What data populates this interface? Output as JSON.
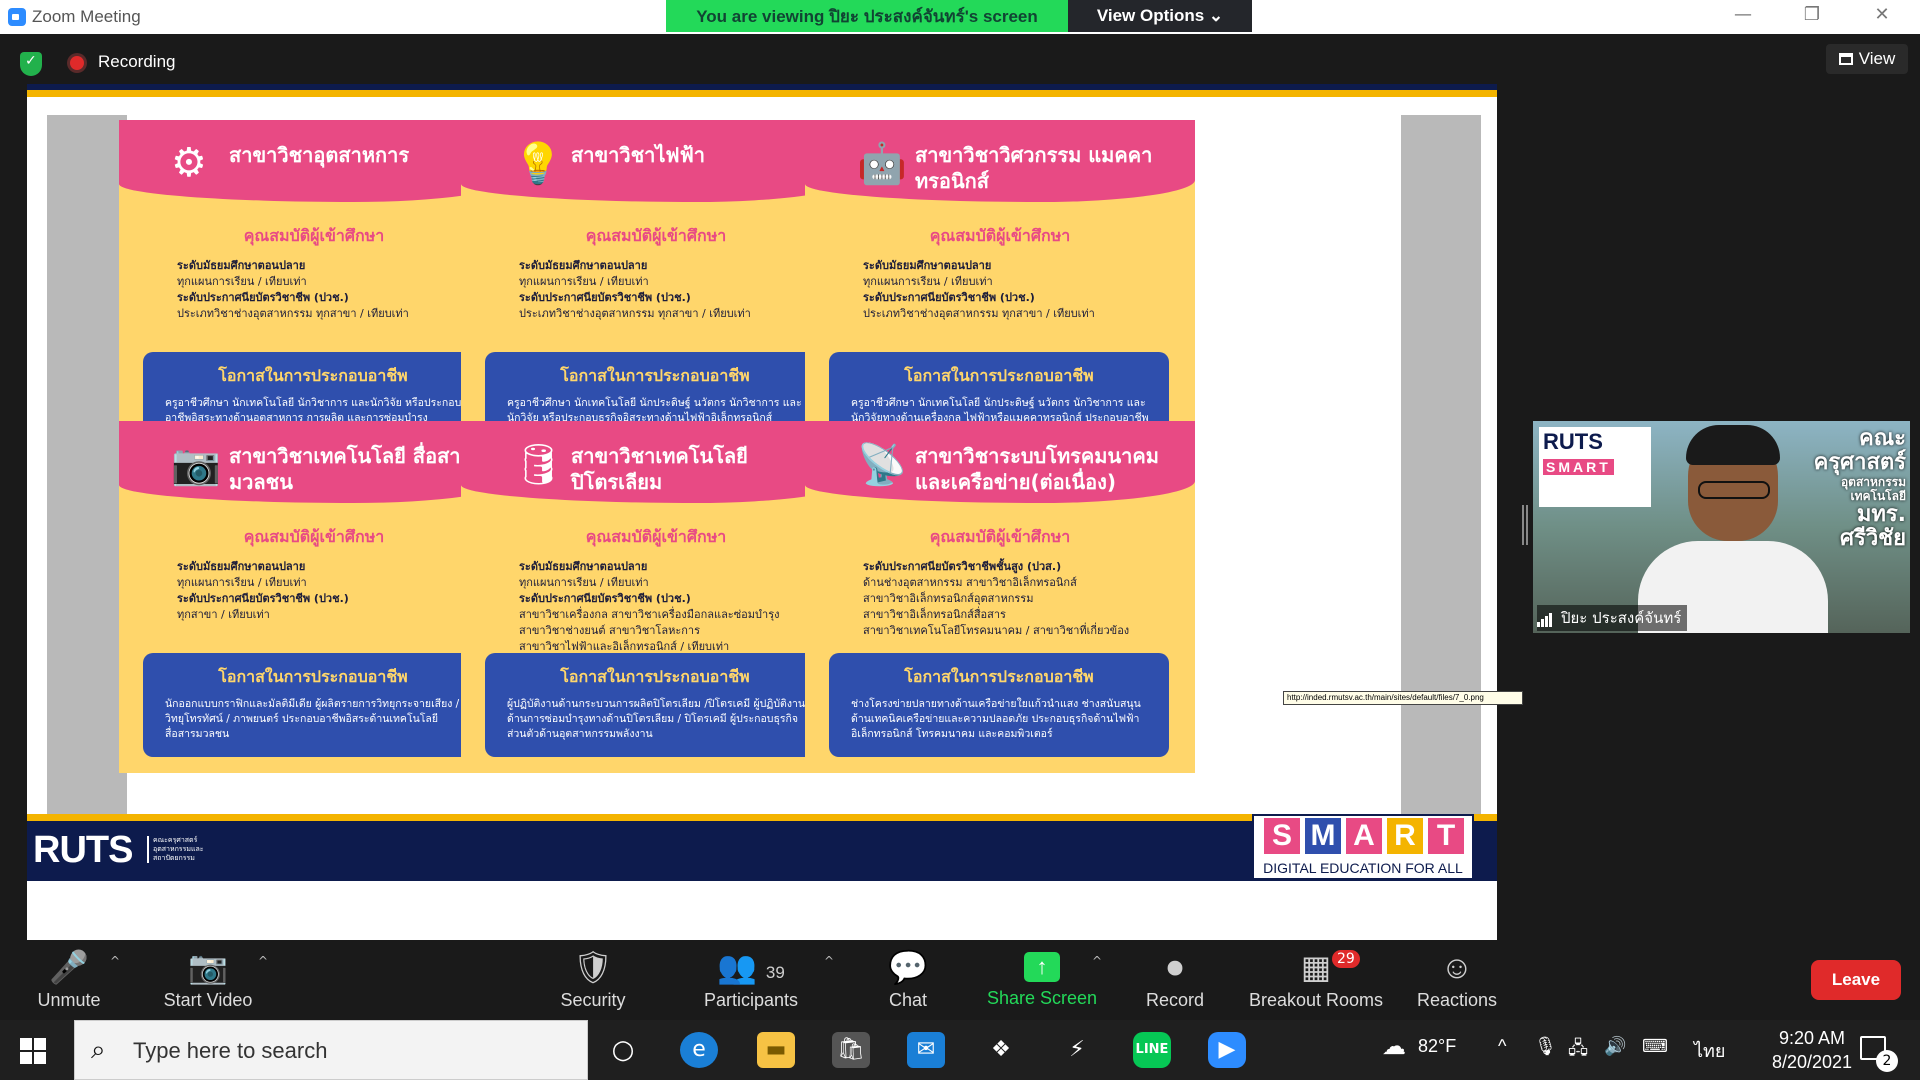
{
  "titlebar": {
    "title": "Zoom Meeting",
    "viewing": "You are viewing ปิยะ ประสงค์จันทร์'s screen",
    "view_options": "View Options ⌄",
    "minimize": "—",
    "restore": "❐",
    "close": "✕"
  },
  "meeting": {
    "recording": "Recording",
    "view_label": "View"
  },
  "cards": [
    {
      "title": "สาขาวิชาอุตสาหการ",
      "icon": "⚙",
      "sub": "คุณสมบัติผู้เข้าศึกษา",
      "body": [
        {
          "t": "ระดับมัธยมศึกษาตอนปลาย",
          "b": true
        },
        {
          "t": "ทุกแผนการเรียน / เทียบเท่า",
          "b": false
        },
        {
          "t": "ระดับประกาศนียบัตรวิชาชีพ (ปวช.)",
          "b": true
        },
        {
          "t": "ประเภทวิชาช่างอุตสาหกรรม ทุกสาขา / เทียบเท่า",
          "b": false
        }
      ],
      "opp_title": "โอกาสในการประกอบอาชีพ",
      "opp_text": "ครูอาชีวศึกษา นักเทคโนโลยี นักวิชาการ และนักวิจัย หรือประกอบอาชีพอิสระทางด้านอุตสาหการ การผลิต และการซ่อมบำรุง"
    },
    {
      "title": "สาขาวิชาไฟฟ้า",
      "icon": "💡",
      "sub": "คุณสมบัติผู้เข้าศึกษา",
      "body": [
        {
          "t": "ระดับมัธยมศึกษาตอนปลาย",
          "b": true
        },
        {
          "t": "ทุกแผนการเรียน / เทียบเท่า",
          "b": false
        },
        {
          "t": "ระดับประกาศนียบัตรวิชาชีพ (ปวช.)",
          "b": true
        },
        {
          "t": "ประเภทวิชาช่างอุตสาหกรรม ทุกสาขา / เทียบเท่า",
          "b": false
        }
      ],
      "opp_title": "โอกาสในการประกอบอาชีพ",
      "opp_text": "ครูอาชีวศึกษา นักเทคโนโลยี นักประดิษฐ์ นวัตกร นักวิชาการ และนักวิจัย หรือประกอบธุรกิจอิสระทางด้านไฟฟ้าอิเล็กทรอนิกส์ โทรคมนาคม และคอมพิวเตอร์"
    },
    {
      "title": "สาขาวิชาวิศวกรรม แมคคาทรอนิกส์",
      "icon": "🤖",
      "sub": "คุณสมบัติผู้เข้าศึกษา",
      "body": [
        {
          "t": "ระดับมัธยมศึกษาตอนปลาย",
          "b": true
        },
        {
          "t": "ทุกแผนการเรียน / เทียบเท่า",
          "b": false
        },
        {
          "t": "ระดับประกาศนียบัตรวิชาชีพ (ปวช.)",
          "b": true
        },
        {
          "t": "ประเภทวิชาช่างอุตสาหกรรม ทุกสาขา / เทียบเท่า",
          "b": false
        }
      ],
      "opp_title": "โอกาสในการประกอบอาชีพ",
      "opp_text": "ครูอาชีวศึกษา นักเทคโนโลยี นักประดิษฐ์ นวัตกร นักวิชาการ และนักวิจัยทางด้านเครื่องกล ไฟฟ้าหรือแมคคาทรอนิกส์ ประกอบอาชีพในระบบการผลิตที่เป็นระบบควบคุมอัตโนมัติ"
    },
    {
      "title": "สาขาวิชาเทคโนโลยี สื่อสารมวลชน",
      "icon": "📷",
      "sub": "คุณสมบัติผู้เข้าศึกษา",
      "body": [
        {
          "t": "ระดับมัธยมศึกษาตอนปลาย",
          "b": true
        },
        {
          "t": "ทุกแผนการเรียน / เทียบเท่า",
          "b": false
        },
        {
          "t": "ระดับประกาศนียบัตรวิชาชีพ (ปวช.)",
          "b": true
        },
        {
          "t": "ทุกสาขา / เทียบเท่า",
          "b": false
        }
      ],
      "opp_title": "โอกาสในการประกอบอาชีพ",
      "opp_text": "นักออกแบบกราฟิกและมัลติมีเดีย ผู้ผลิตรายการวิทยุกระจายเสียง / วิทยุโทรทัศน์ / ภาพยนตร์ ประกอบอาชีพอิสระด้านเทคโนโลยีสื่อสารมวลชน"
    },
    {
      "title": "สาขาวิชาเทคโนโลยี ปิโตรเลียม",
      "icon": "🛢",
      "sub": "คุณสมบัติผู้เข้าศึกษา",
      "body": [
        {
          "t": "ระดับมัธยมศึกษาตอนปลาย",
          "b": true
        },
        {
          "t": "ทุกแผนการเรียน / เทียบเท่า",
          "b": false
        },
        {
          "t": "ระดับประกาศนียบัตรวิชาชีพ (ปวช.)",
          "b": true
        },
        {
          "t": "สาขาวิชาเครื่องกล สาขาวิชาเครื่องมือกลและซ่อมบำรุง",
          "b": false
        },
        {
          "t": "สาขาวิชาช่างยนต์ สาขาวิชาโลหะการ",
          "b": false
        },
        {
          "t": "สาขาวิชาไฟฟ้าและอิเล็กทรอนิกส์ / เทียบเท่า",
          "b": false
        }
      ],
      "opp_title": "โอกาสในการประกอบอาชีพ",
      "opp_text": "ผู้ปฏิบัติงานด้านกระบวนการผลิตปิโตรเลียม /ปิโตรเคมี ผู้ปฏิบัติงานด้านการซ่อมบำรุงทางด้านปิโตรเลียม / ปิโตรเคมี ผู้ประกอบธุรกิจส่วนตัวด้านอุตสาหกรรมพลังงาน"
    },
    {
      "title": "สาขาวิชาระบบโทรคมนาคม และเครือข่าย(ต่อเนื่อง)",
      "icon": "📡",
      "sub": "คุณสมบัติผู้เข้าศึกษา",
      "body": [
        {
          "t": "ระดับประกาศนียบัตรวิชาชีพชั้นสูง (ปวส.)",
          "b": true
        },
        {
          "t": "ด้านช่างอุตสาหกรรม สาขาวิชาอิเล็กทรอนิกส์",
          "b": false
        },
        {
          "t": "สาขาวิชาอิเล็กทรอนิกส์อุตสาหกรรม",
          "b": false
        },
        {
          "t": "สาขาวิชาอิเล็กทรอนิกส์สื่อสาร",
          "b": false
        },
        {
          "t": "สาขาวิชาเทคโนโลยีโทรคมนาคม / สาขาวิชาที่เกี่ยวข้อง",
          "b": false
        }
      ],
      "opp_title": "โอกาสในการประกอบอาชีพ",
      "opp_text": "ช่างโครงข่ายปลายทางด้านเครือข่ายใยแก้วนำแสง ช่างสนับสนุน ด้านเทคนิคเครือข่ายและความปลอดภัย ประกอบธุรกิจด้านไฟฟ้า อิเล็กทรอนิกส์ โทรคมนาคม และคอมพิวเตอร์"
    }
  ],
  "slide_footer": {
    "ruts": "RUTS",
    "faculty": "คณะครุศาสตร์อุตสาหกรรมและสถาปัตยกรรม",
    "smart_letters": [
      "S",
      "M",
      "A",
      "R",
      "T"
    ],
    "smart_sub": "DIGITAL EDUCATION FOR ALL"
  },
  "url_tooltip": "http://inded.rmutsv.ac.th/main/sites/default/files/7_0.png",
  "video": {
    "logo_ruts": "RUTS",
    "logo_smart": "SMART",
    "right_text": "คณะ\nครุศาสตร์\nอุตสาหกรรม\nเทคโนโลยี\nมทร.\nศรีวิชัย",
    "name": "ปิยะ ประสงค์จันทร์"
  },
  "toolbar": {
    "unmute": "Unmute",
    "start_video": "Start Video",
    "security": "Security",
    "participants": "Participants",
    "participants_count": "39",
    "chat": "Chat",
    "share_screen": "Share Screen",
    "record": "Record",
    "breakout_rooms": "Breakout Rooms",
    "breakout_count": "29",
    "reactions": "Reactions",
    "leave": "Leave"
  },
  "taskbar": {
    "search_placeholder": "Type here to search",
    "temp": "82°F",
    "lang": "ไทย",
    "time": "9:20 AM",
    "date": "8/20/2021",
    "notif_count": "2"
  }
}
